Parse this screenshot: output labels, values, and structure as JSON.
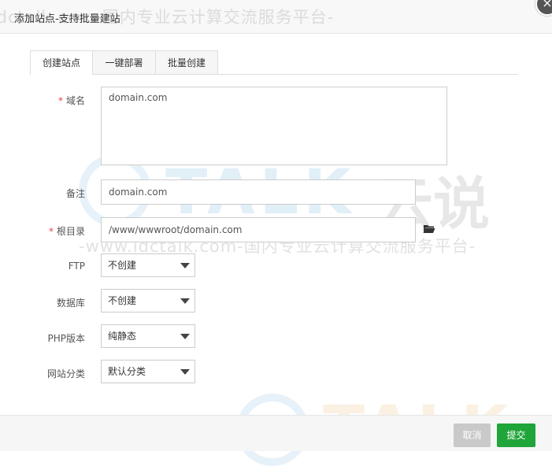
{
  "dialog": {
    "title": "添加站点-支持批量建站",
    "close_glyph": "×"
  },
  "tabs": [
    {
      "label": "创建站点",
      "active": true
    },
    {
      "label": "一键部署",
      "active": false
    },
    {
      "label": "批量创建",
      "active": false
    }
  ],
  "form": {
    "required_mark": "*",
    "domain": {
      "label": "域名",
      "value": "domain.com"
    },
    "remark": {
      "label": "备注",
      "value": "domain.com"
    },
    "root": {
      "label": "根目录",
      "value": "/www/wwwroot/domain.com"
    },
    "ftp": {
      "label": "FTP",
      "value": "不创建"
    },
    "database": {
      "label": "数据库",
      "value": "不创建"
    },
    "php": {
      "label": "PHP版本",
      "value": "纯静态"
    },
    "category": {
      "label": "网站分类",
      "value": "默认分类"
    }
  },
  "buttons": {
    "cancel": "取消",
    "submit": "提交"
  },
  "watermark": {
    "top_line": "-www.idctalk.com-国内专业云计算交流服务平台-",
    "mid_line": "-www.idctalk.com-国内专业云计算交流服务平台-",
    "brand_talk": "TALK",
    "brand_cn": "云说",
    "bottom_talk": "TALK"
  },
  "colors": {
    "accent": "#20a53a",
    "required": "#e54545",
    "cancel": "#c9c9c9"
  },
  "icons": [
    "close-icon",
    "folder-open-icon",
    "chevron-down-icon"
  ]
}
